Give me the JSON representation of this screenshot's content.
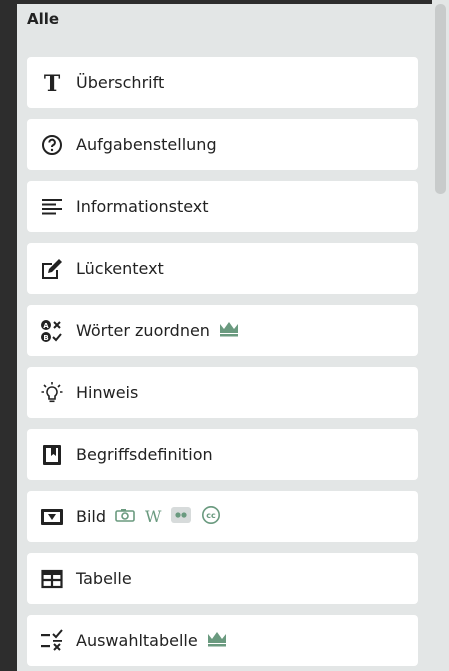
{
  "section": {
    "title": "Alle"
  },
  "items": [
    {
      "label": "Überschrift",
      "icon": "heading-icon"
    },
    {
      "label": "Aufgabenstellung",
      "icon": "question-circle-icon"
    },
    {
      "label": "Informationstext",
      "icon": "text-lines-icon"
    },
    {
      "label": "Lückentext",
      "icon": "edit-box-icon"
    },
    {
      "label": "Wörter zuordnen",
      "icon": "match-words-icon",
      "badges": [
        "crown-icon"
      ]
    },
    {
      "label": "Hinweis",
      "icon": "lightbulb-icon"
    },
    {
      "label": "Begriffsdefinition",
      "icon": "bookmark-book-icon"
    },
    {
      "label": "Bild",
      "icon": "image-icon",
      "badges": [
        "camera-icon",
        "wikipedia-icon",
        "flickr-icon",
        "creative-commons-icon"
      ],
      "wikipedia_glyph": "W"
    },
    {
      "label": "Tabelle",
      "icon": "table-icon"
    },
    {
      "label": "Auswahltabelle",
      "icon": "choice-table-icon",
      "badges": [
        "crown-icon"
      ]
    }
  ],
  "colors": {
    "accent_green": "#6a9a7f",
    "panel_bg": "#e3e6e6",
    "frame_bg": "#2d2d2d"
  }
}
